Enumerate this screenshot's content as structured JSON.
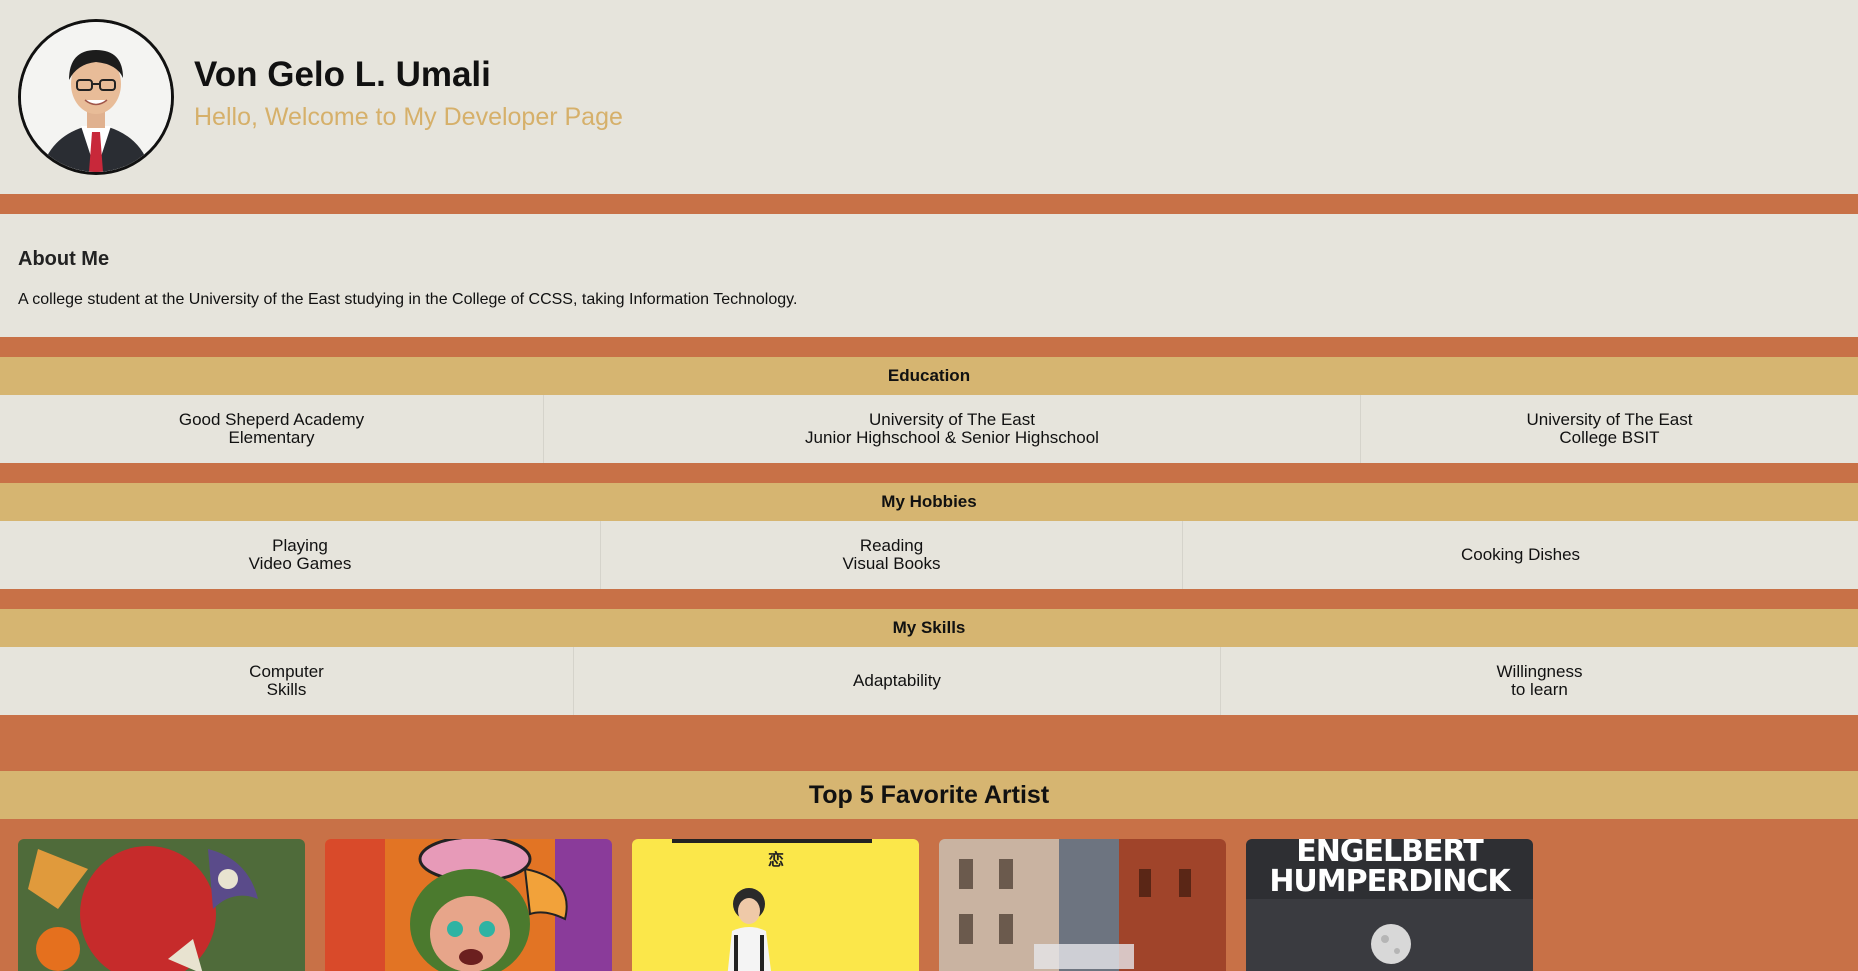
{
  "header": {
    "name": "Von Gelo L. Umali",
    "tagline": "Hello, Welcome to My Developer Page"
  },
  "about": {
    "heading": "About Me",
    "text": "A college student at the University of the East studying in the College of CCSS, taking Information Technology."
  },
  "education": {
    "title": "Education",
    "items": [
      "Good Sheperd Academy\nElementary",
      "University of The East\nJunior Highschool & Senior Highschool",
      "University of The East\nCollege BSIT"
    ]
  },
  "hobbies": {
    "title": "My Hobbies",
    "items": [
      "Playing\nVideo Games",
      "Reading\nVisual Books",
      "Cooking Dishes"
    ]
  },
  "skills": {
    "title": "My Skills",
    "items": [
      "Computer\nSkills",
      "Adaptability",
      "Willingness\nto learn"
    ]
  },
  "artists": {
    "title": "Top 5 Favorite Artist",
    "cards": [
      {
        "icon": "album-art-red-balloon"
      },
      {
        "icon": "album-art-cartoon-head"
      },
      {
        "icon": "album-art-yellow-portrait",
        "cover_text": "恋"
      },
      {
        "icon": "album-art-alley"
      },
      {
        "icon": "album-art-moon",
        "cover_text": "ENGELBERT\nHUMPERDINCK"
      }
    ]
  },
  "colors": {
    "background": "#c87147",
    "panel": "#e6e4dc",
    "section_header": "#d6b571",
    "tagline": "#d6b06a"
  }
}
